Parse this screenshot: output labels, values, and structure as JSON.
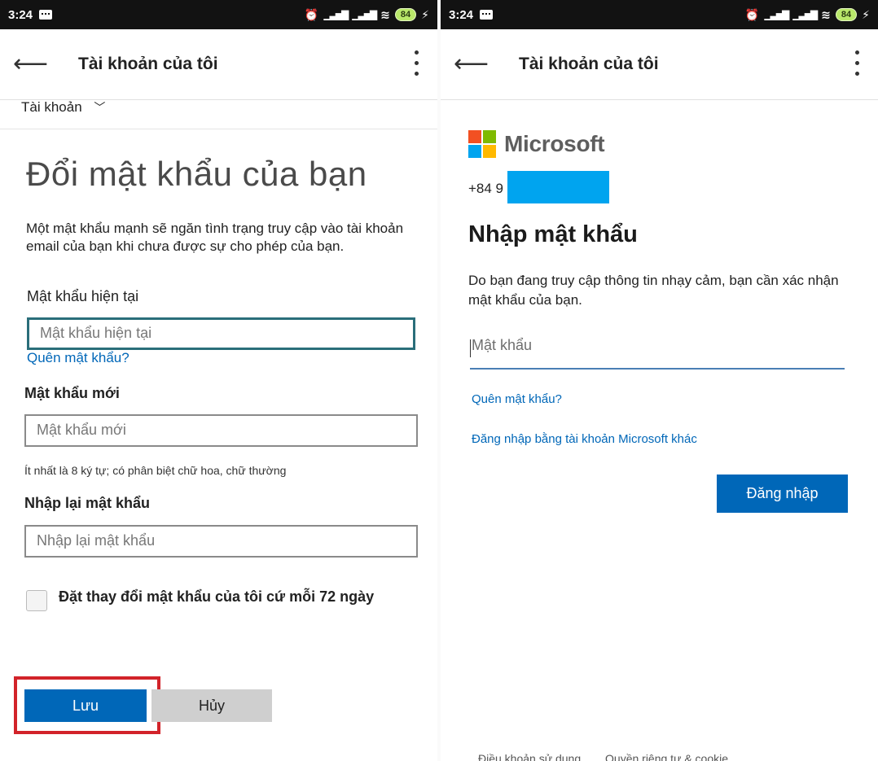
{
  "status_bar": {
    "time": "3:24",
    "battery": "84",
    "icons": [
      "message-icon",
      "alarm-icon",
      "signal-icon",
      "signal-icon",
      "wifi-icon",
      "battery-icon",
      "charging-icon"
    ]
  },
  "left": {
    "app_bar": {
      "title": "Tài khoản của tôi"
    },
    "account_dropdown": "Tài khoản",
    "heading": "Đổi mật khẩu của bạn",
    "description": "Một mật khẩu mạnh sẽ ngăn tình trạng truy cập vào tài khoản email của bạn khi chưa được sự cho phép của bạn.",
    "current_password": {
      "label": "Mật khẩu hiện tại",
      "placeholder": "Mật khẩu hiện tại"
    },
    "forgot_link": "Quên mật khẩu?",
    "new_password": {
      "label": "Mật khẩu mới",
      "placeholder": "Mật khẩu mới"
    },
    "hint": "Ít nhất là 8 ký tự; có phân biệt chữ hoa, chữ thường",
    "confirm_password": {
      "label": "Nhập lại mật khẩu",
      "placeholder": "Nhập lại mật khẩu"
    },
    "checkbox_label": "Đặt thay đổi mật khẩu của tôi cứ mỗi 72 ngày",
    "save_label": "Lưu",
    "cancel_label": "Hủy",
    "highlight_color": "#d2232a"
  },
  "right": {
    "app_bar": {
      "title": "Tài khoản của tôi"
    },
    "brand": "Microsoft",
    "brand_colors": [
      "#f25022",
      "#7fba00",
      "#00a4ef",
      "#ffb900"
    ],
    "phone_prefix": "+84 9",
    "heading": "Nhập mật khẩu",
    "description": "Do bạn đang truy cập thông tin nhạy cảm, bạn cần xác nhận mật khẩu của bạn.",
    "password_placeholder": "Mật khẩu",
    "forgot_link": "Quên mật khẩu?",
    "other_account_link": "Đăng nhập bằng tài khoản Microsoft khác",
    "signin_label": "Đăng nhập",
    "footer": {
      "terms": "Điều khoản sử dụng",
      "privacy": "Quyền riêng tư & cookie",
      "more": "..."
    }
  },
  "accent_color": "#0067b8"
}
